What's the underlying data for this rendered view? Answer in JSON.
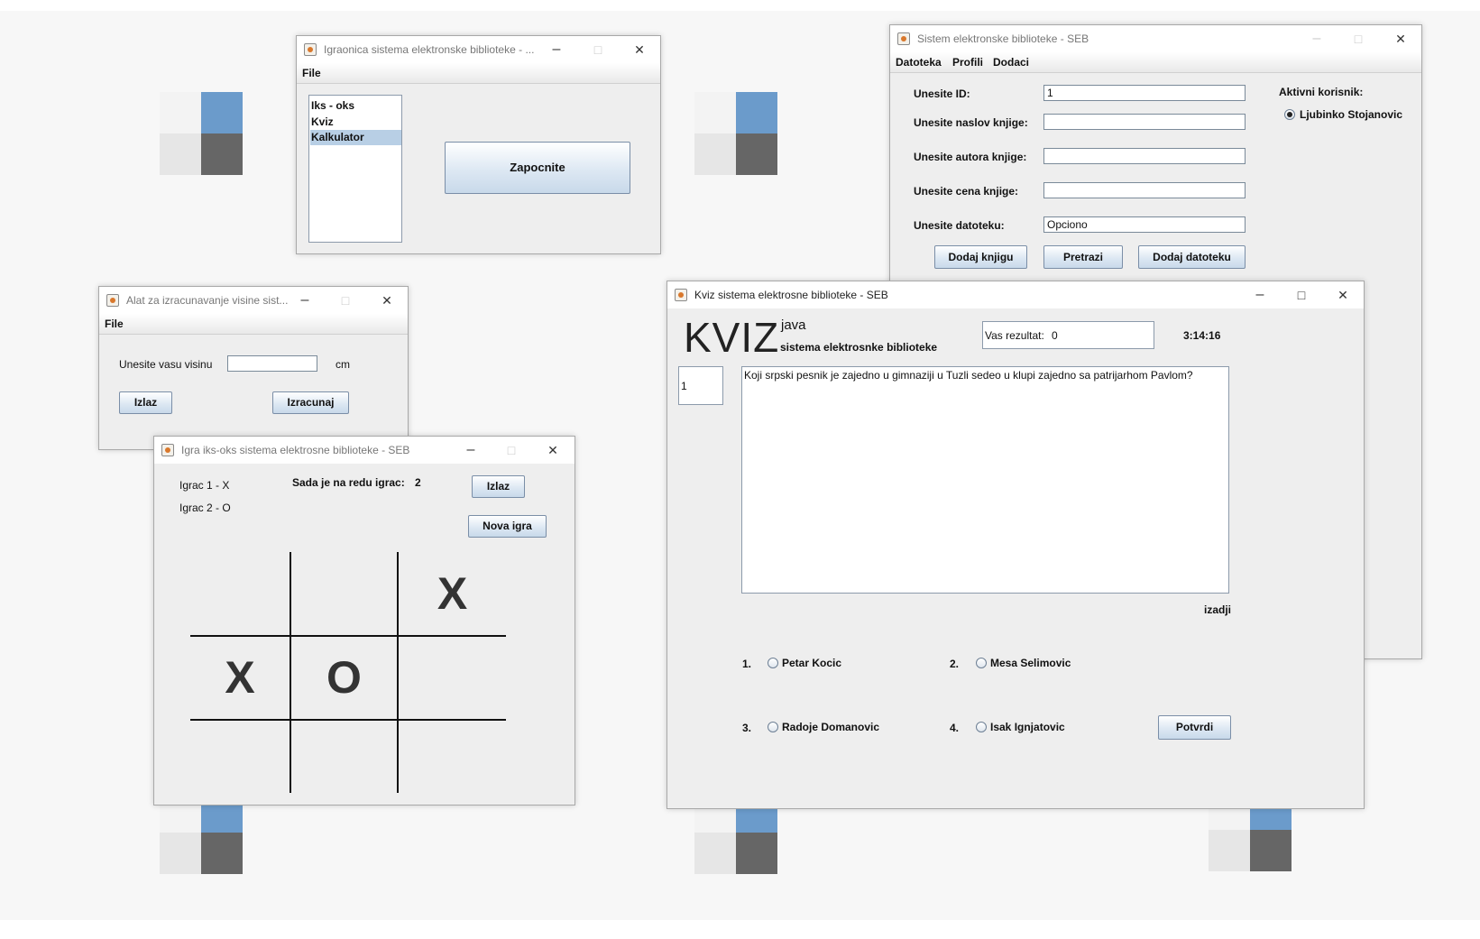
{
  "library_window": {
    "title": "Sistem elektronske biblioteke - SEB",
    "menu": [
      "Datoteka",
      "Profili",
      "Dodaci"
    ],
    "fields": [
      {
        "label": "Unesite ID:",
        "value": "1"
      },
      {
        "label": "Unesite naslov knjige:",
        "value": ""
      },
      {
        "label": "Unesite autora knjige:",
        "value": ""
      },
      {
        "label": "Unesite cena knjige:",
        "value": ""
      },
      {
        "label": "Unesite datoteku:",
        "value": "Opciono"
      }
    ],
    "buttons": {
      "add_book": "Dodaj knjigu",
      "search": "Pretrazi",
      "add_file": "Dodaj datoteku"
    },
    "active_user_label": "Aktivni korisnik:",
    "active_user": "Ljubinko Stojanovic"
  },
  "playroom_window": {
    "title": "Igraonica sistema elektronske biblioteke - ...",
    "menu": [
      "File"
    ],
    "games": [
      "Iks - oks",
      "Kviz",
      "Kalkulator"
    ],
    "selected_game": "Kalkulator",
    "start_button": "Zapocnite"
  },
  "height_window": {
    "title": "Alat za izracunavanje visine sist...",
    "menu": [
      "File"
    ],
    "prompt": "Unesite vasu visinu",
    "value": "",
    "unit": "cm",
    "exit_button": "Izlaz",
    "calc_button": "Izracunaj"
  },
  "tictactoe_window": {
    "title": "Igra iks-oks sistema elektrosne biblioteke - SEB",
    "player1": "Igrac 1 - X",
    "player2": "Igrac 2 - O",
    "turn_label": "Sada je na redu igrac:",
    "turn_value": "2",
    "exit_button": "Izlaz",
    "new_game_button": "Nova igra",
    "board": [
      "",
      "",
      "X",
      "X",
      "O",
      "",
      "",
      "",
      ""
    ]
  },
  "quiz_window": {
    "title": "Kviz sistema elektrosne biblioteke - SEB",
    "logo": "KVIZ",
    "logo_sub1": "java",
    "logo_sub2": "sistema elektrosnke biblioteke",
    "score_label": "Vas rezultat:",
    "score_value": "0",
    "timer": "3:14:16",
    "question_number": "1",
    "question": "Koji srpski pesnik je zajedno u gimnaziji u Tuzli sedeo u klupi zajedno sa patrijarhom Pavlom?",
    "exit_link": "izadji",
    "answers": [
      {
        "num": "1.",
        "text": "Petar Kocic"
      },
      {
        "num": "2.",
        "text": "Mesa Selimovic"
      },
      {
        "num": "3.",
        "text": "Radoje Domanovic"
      },
      {
        "num": "4.",
        "text": "Isak Ignjatovic"
      }
    ],
    "confirm_button": "Potvrdi"
  }
}
